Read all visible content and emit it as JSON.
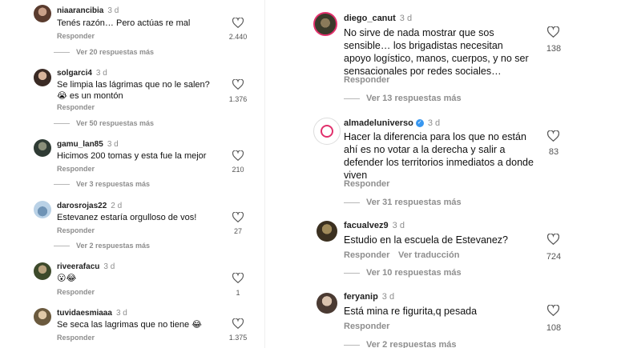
{
  "left": {
    "comments": [
      {
        "user": "niaarancibia",
        "time": "3 d",
        "text": "Tenés razón… Pero actúas re mal",
        "reply": "Responder",
        "likes": "2.440",
        "more": "Ver 20 respuestas más"
      },
      {
        "user": "solgarci4",
        "time": "3 d",
        "text": "Se limpia las lágrimas que no le salen? 😭 es un montón",
        "reply": "Responder",
        "likes": "1.376",
        "more": "Ver 50 respuestas más"
      },
      {
        "user": "gamu_lan85",
        "time": "3 d",
        "text": "Hicimos 200 tomas y esta fue la mejor",
        "reply": "Responder",
        "likes": "210",
        "more": "Ver 3 respuestas más"
      },
      {
        "user": "darosrojas22",
        "time": "2 d",
        "text": "Estevanez estaría orgulloso de vos!",
        "reply": "Responder",
        "likes": "27",
        "more": "Ver 2 respuestas más"
      },
      {
        "user": "riveerafacu",
        "time": "3 d",
        "text": "😮😂",
        "reply": "Responder",
        "likes": "1"
      },
      {
        "user": "tuvidaesmiaaa",
        "time": "3 d",
        "text": "Se seca las lagrimas que no tiene 😂",
        "reply": "Responder",
        "likes": "1.375"
      }
    ]
  },
  "right": {
    "comments": [
      {
        "user": "diego_canut",
        "time": "3 d",
        "text": "No sirve de nada mostrar que sos sensible… los brigadistas necesitan apoyo logístico, manos, cuerpos, y no ser sensacionales por redes sociales…",
        "reply": "Responder",
        "likes": "138",
        "more": "Ver 13 respuestas más"
      },
      {
        "user": "almadeluniverso",
        "time": "3 d",
        "verified": "✓",
        "text": "Hacer la diferencia para los que no están ahí es no votar a la derecha y salir a defender los territorios inmediatos a donde viven",
        "reply": "Responder",
        "likes": "83",
        "more": "Ver 31 respuestas más"
      },
      {
        "user": "facualvez9",
        "time": "3 d",
        "text": "Estudio en la escuela de Estevanez?",
        "reply": "Responder",
        "translate": "Ver traducción",
        "likes": "724",
        "more": "Ver 10 respuestas más"
      },
      {
        "user": "feryanip",
        "time": "3 d",
        "text": "Está mina re figurita,q pesada",
        "reply": "Responder",
        "likes": "108",
        "more": "Ver 2 respuestas más"
      }
    ]
  },
  "colors": {
    "muted": "#8e8e8e",
    "text": "#111111",
    "verified": "#3897f0"
  },
  "icons": {
    "like": "heart-outline-icon"
  }
}
